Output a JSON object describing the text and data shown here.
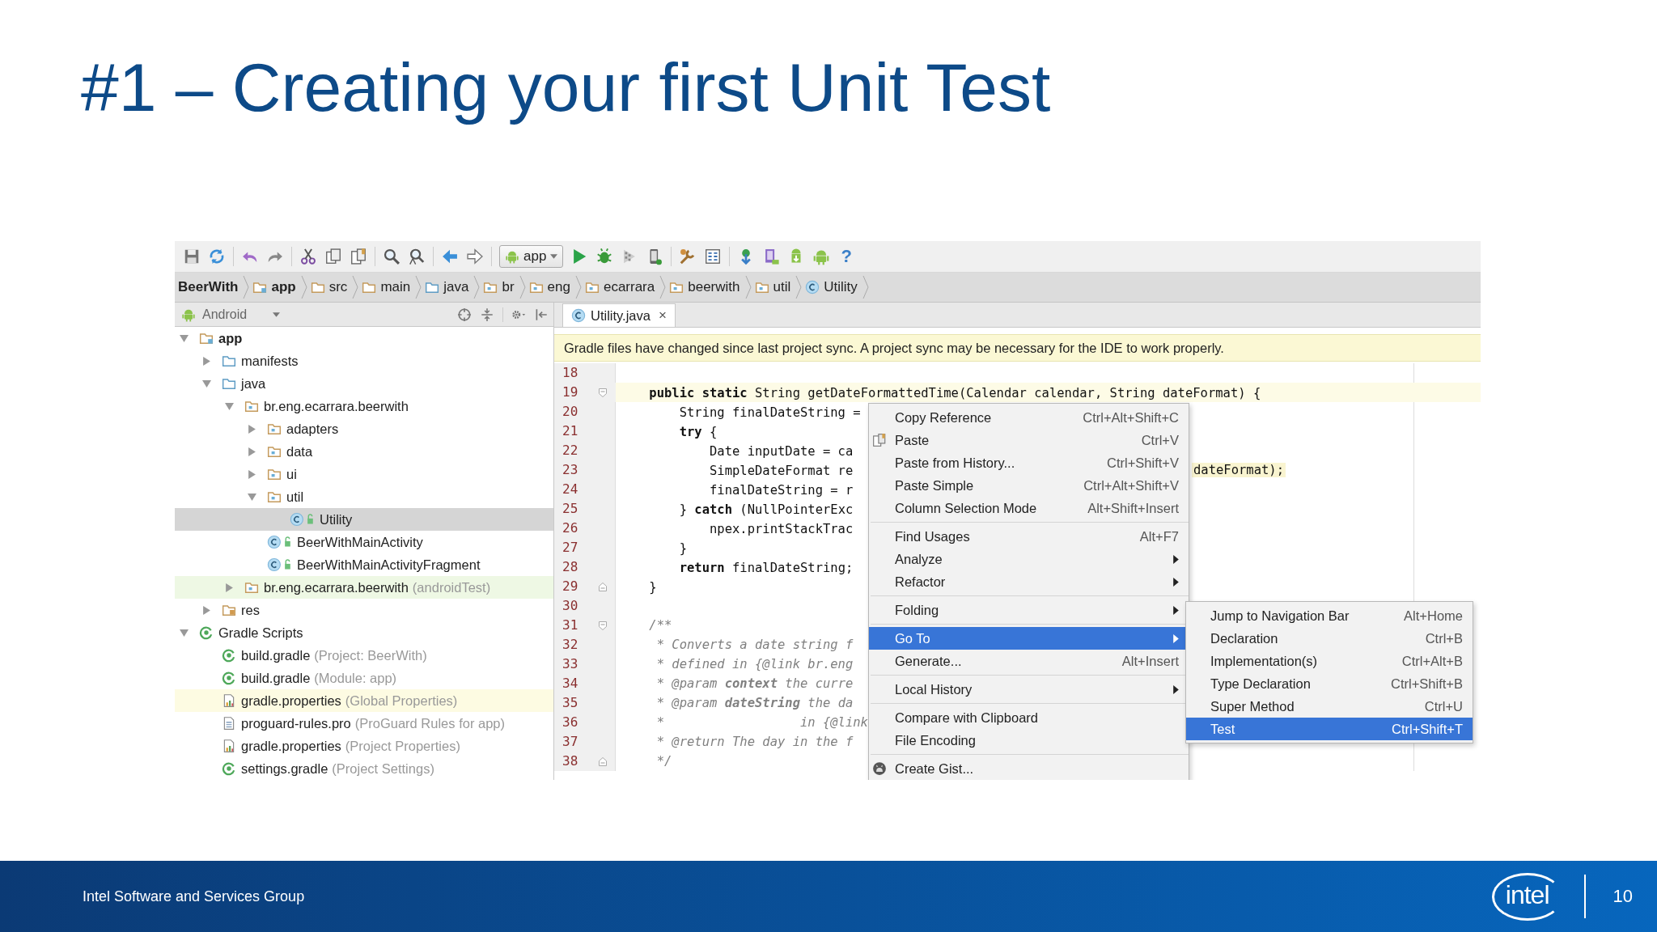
{
  "slide": {
    "title": "#1 – Creating your first Unit Test",
    "footer": "Intel Software and Services Group",
    "logo": "intel",
    "page": "10"
  },
  "toolbar": {
    "run_config": "app",
    "help": "?"
  },
  "breadcrumbs": [
    {
      "label": "BeerWith",
      "kind": "project"
    },
    {
      "label": "app",
      "kind": "module"
    },
    {
      "label": "src",
      "kind": "folder"
    },
    {
      "label": "main",
      "kind": "folder"
    },
    {
      "label": "java",
      "kind": "source"
    },
    {
      "label": "br",
      "kind": "package"
    },
    {
      "label": "eng",
      "kind": "package"
    },
    {
      "label": "ecarrara",
      "kind": "package"
    },
    {
      "label": "beerwith",
      "kind": "package"
    },
    {
      "label": "util",
      "kind": "package"
    },
    {
      "label": "Utility",
      "kind": "class"
    }
  ],
  "project_panel": {
    "view": "Android"
  },
  "project_tree": [
    {
      "name": "app",
      "kind": "module",
      "expanded": true,
      "selected": false,
      "children": [
        {
          "name": "manifests",
          "kind": "source",
          "expanded": false,
          "selected": false
        },
        {
          "name": "java",
          "kind": "source",
          "expanded": true,
          "selected": false,
          "children": [
            {
              "name": "br.eng.ecarrara.beerwith",
              "kind": "package",
              "expanded": true,
              "selected": false,
              "children": [
                {
                  "name": "adapters",
                  "kind": "package",
                  "expanded": false,
                  "selected": false
                },
                {
                  "name": "data",
                  "kind": "package",
                  "expanded": false,
                  "selected": false
                },
                {
                  "name": "ui",
                  "kind": "package",
                  "expanded": false,
                  "selected": false
                },
                {
                  "name": "util",
                  "kind": "package",
                  "expanded": true,
                  "selected": false,
                  "children": [
                    {
                      "name": "Utility",
                      "kind": "class",
                      "selected": true
                    }
                  ]
                },
                {
                  "name": "BeerWithMainActivity",
                  "kind": "class",
                  "selected": false
                },
                {
                  "name": "BeerWithMainActivityFragment",
                  "kind": "class",
                  "selected": false
                }
              ]
            },
            {
              "name": "br.eng.ecarrara.beerwith",
              "hint": "(androidTest)",
              "kind": "package",
              "expanded": false,
              "selected": false,
              "color": "#eef8e4"
            }
          ]
        },
        {
          "name": "res",
          "kind": "res",
          "expanded": false,
          "selected": false
        }
      ]
    },
    {
      "name": "Gradle Scripts",
      "kind": "gradle",
      "expanded": true,
      "selected": false,
      "children": [
        {
          "name": "build.gradle",
          "hint": "(Project: BeerWith)",
          "kind": "gradle",
          "selected": false
        },
        {
          "name": "build.gradle",
          "hint": "(Module: app)",
          "kind": "gradle",
          "selected": false
        },
        {
          "name": "gradle.properties",
          "hint": "(Global Properties)",
          "kind": "properties",
          "selected": false,
          "color": "#fdfbe2"
        },
        {
          "name": "proguard-rules.pro",
          "hint": "(ProGuard Rules for app)",
          "kind": "text",
          "selected": false
        },
        {
          "name": "gradle.properties",
          "hint": "(Project Properties)",
          "kind": "properties",
          "selected": false
        },
        {
          "name": "settings.gradle",
          "hint": "(Project Settings)",
          "kind": "gradle",
          "selected": false
        }
      ]
    }
  ],
  "editor": {
    "tab": "Utility.java",
    "close": "×",
    "banner": "Gradle files have changed since last project sync. A project sync may be necessary for the IDE to work properly."
  },
  "code": {
    "lines": [
      {
        "n": "18",
        "kind": "code",
        "current": false
      },
      {
        "n": "19",
        "kind": "code",
        "current": true,
        "text": "    **public static** String getDateFormattedTime(Calendar calendar, String dateFormat) {"
      },
      {
        "n": "20",
        "kind": "code",
        "current": false,
        "text": "        String finalDateString ="
      },
      {
        "n": "21",
        "kind": "code",
        "current": false,
        "text": "        **try** {"
      },
      {
        "n": "22",
        "kind": "code",
        "current": false,
        "text": "            Date inputDate = ca"
      },
      {
        "n": "23",
        "kind": "code",
        "current": false,
        "text": "            SimpleDateFormat re",
        "right": "dateFormat);"
      },
      {
        "n": "24",
        "kind": "code",
        "current": false,
        "text": "            finalDateString = r"
      },
      {
        "n": "25",
        "kind": "code",
        "current": false,
        "text": "        } **catch** (NullPointerExc"
      },
      {
        "n": "26",
        "kind": "code",
        "current": false,
        "text": "            npex.printStackTrac"
      },
      {
        "n": "27",
        "kind": "code",
        "current": false,
        "text": "        }"
      },
      {
        "n": "28",
        "kind": "code",
        "current": false,
        "text": "        **return** finalDateString;"
      },
      {
        "n": "29",
        "kind": "code",
        "current": false,
        "text": "    }"
      },
      {
        "n": "30",
        "kind": "code",
        "current": false
      },
      {
        "n": "31",
        "kind": "comment",
        "current": false,
        "text": "    /**"
      },
      {
        "n": "32",
        "kind": "comment",
        "current": false,
        "text": "     * Converts a date string f"
      },
      {
        "n": "33",
        "kind": "comment",
        "current": false,
        "text": "     * defined in {@link br.eng"
      },
      {
        "n": "34",
        "kind": "comment",
        "current": false,
        "text": "     * @param **context** the curre"
      },
      {
        "n": "35",
        "kind": "comment",
        "current": false,
        "text": "     * @param **dateString** the da"
      },
      {
        "n": "36",
        "kind": "comment",
        "current": false,
        "text": "     *                  in {@link"
      },
      {
        "n": "37",
        "kind": "comment",
        "current": false,
        "text": "     * @return The day in the f"
      },
      {
        "n": "38",
        "kind": "comment",
        "current": false,
        "text": "     */"
      }
    ]
  },
  "context_menu": [
    {
      "kind": "item",
      "label": "Copy Reference",
      "shortcut": "Ctrl+Alt+Shift+C",
      "selected": false
    },
    {
      "kind": "item",
      "label": "Paste",
      "shortcut": "Ctrl+V",
      "selected": false
    },
    {
      "kind": "item",
      "label": "Paste from History...",
      "shortcut": "Ctrl+Shift+V",
      "selected": false
    },
    {
      "kind": "item",
      "label": "Paste Simple",
      "shortcut": "Ctrl+Alt+Shift+V",
      "selected": false
    },
    {
      "kind": "item",
      "label": "Column Selection Mode",
      "shortcut": "Alt+Shift+Insert",
      "selected": false
    },
    {
      "kind": "separator"
    },
    {
      "kind": "item",
      "label": "Find Usages",
      "shortcut": "Alt+F7",
      "selected": false
    },
    {
      "kind": "item",
      "label": "Analyze",
      "submenu": true,
      "selected": false
    },
    {
      "kind": "item",
      "label": "Refactor",
      "submenu": true,
      "selected": false
    },
    {
      "kind": "separator"
    },
    {
      "kind": "item",
      "label": "Folding",
      "submenu": true,
      "selected": false
    },
    {
      "kind": "separator"
    },
    {
      "kind": "item",
      "label": "Go To",
      "submenu": true,
      "selected": true
    },
    {
      "kind": "item",
      "label": "Generate...",
      "shortcut": "Alt+Insert",
      "selected": false
    },
    {
      "kind": "separator"
    },
    {
      "kind": "item",
      "label": "Local History",
      "submenu": true,
      "selected": false
    },
    {
      "kind": "separator"
    },
    {
      "kind": "item",
      "label": "Compare with Clipboard",
      "selected": false
    },
    {
      "kind": "item",
      "label": "File Encoding",
      "selected": false
    },
    {
      "kind": "separator"
    },
    {
      "kind": "item",
      "label": "Create Gist...",
      "selected": false
    }
  ],
  "submenu": [
    {
      "label": "Jump to Navigation Bar",
      "shortcut": "Alt+Home",
      "selected": false
    },
    {
      "label": "Declaration",
      "shortcut": "Ctrl+B",
      "selected": false
    },
    {
      "label": "Implementation(s)",
      "shortcut": "Ctrl+Alt+B",
      "selected": false
    },
    {
      "label": "Type Declaration",
      "shortcut": "Ctrl+Shift+B",
      "selected": false
    },
    {
      "label": "Super Method",
      "shortcut": "Ctrl+U",
      "selected": false
    },
    {
      "label": "Test",
      "shortcut": "Ctrl+Shift+T",
      "selected": true
    }
  ]
}
